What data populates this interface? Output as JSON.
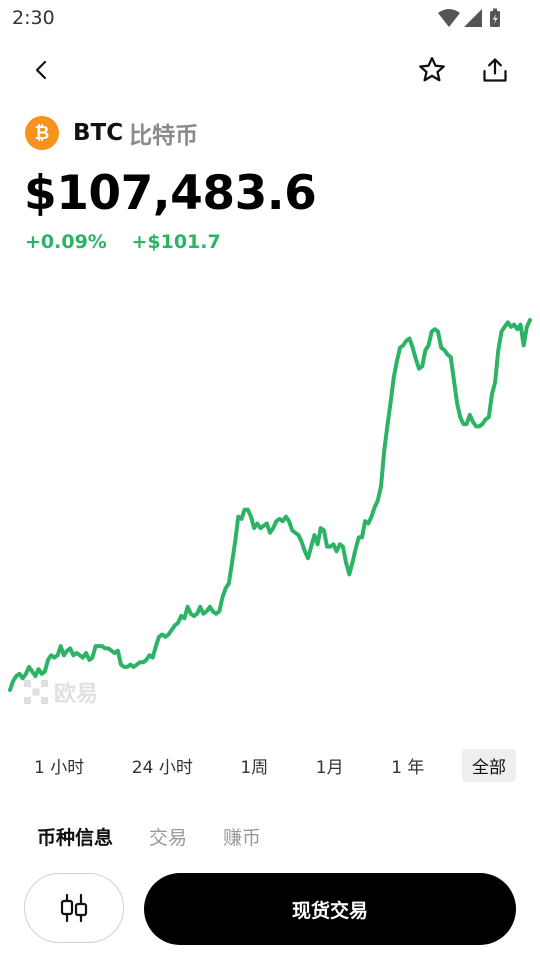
{
  "status_bar": {
    "time": "2:30"
  },
  "coin": {
    "logo_glyph": "₿",
    "logo_color": "#f7931a",
    "symbol": "BTC",
    "name": "比特币"
  },
  "price": "$107,483.6",
  "change": {
    "percent": "+0.09%",
    "amount": "+$101.7",
    "color": "#2db365"
  },
  "watermark": {
    "text": "欧易"
  },
  "chart_data": {
    "type": "line",
    "color": "#2db365",
    "axes_visible": false,
    "grid": false,
    "y": [
      0.05,
      0.09,
      0.11,
      0.12,
      0.1,
      0.12,
      0.15,
      0.13,
      0.11,
      0.14,
      0.12,
      0.13,
      0.18,
      0.2,
      0.19,
      0.2,
      0.24,
      0.2,
      0.22,
      0.23,
      0.2,
      0.21,
      0.2,
      0.19,
      0.21,
      0.18,
      0.19,
      0.24,
      0.24,
      0.24,
      0.23,
      0.23,
      0.22,
      0.21,
      0.22,
      0.16,
      0.15,
      0.15,
      0.16,
      0.15,
      0.16,
      0.17,
      0.17,
      0.18,
      0.2,
      0.19,
      0.24,
      0.28,
      0.29,
      0.28,
      0.29,
      0.31,
      0.33,
      0.34,
      0.37,
      0.36,
      0.41,
      0.38,
      0.37,
      0.38,
      0.41,
      0.38,
      0.39,
      0.41,
      0.39,
      0.38,
      0.39,
      0.45,
      0.49,
      0.51,
      0.6,
      0.69,
      0.8,
      0.79,
      0.83,
      0.83,
      0.8,
      0.75,
      0.77,
      0.75,
      0.76,
      0.77,
      0.73,
      0.75,
      0.78,
      0.79,
      0.78,
      0.8,
      0.78,
      0.74,
      0.73,
      0.72,
      0.69,
      0.65,
      0.62,
      0.67,
      0.72,
      0.68,
      0.75,
      0.74,
      0.67,
      0.67,
      0.68,
      0.65,
      0.68,
      0.67,
      0.6,
      0.55,
      0.6,
      0.66,
      0.71,
      0.71,
      0.78,
      0.77,
      0.8,
      0.84,
      0.87,
      0.93,
      1.08,
      1.19,
      1.29,
      1.4,
      1.47,
      1.53,
      1.54,
      1.56,
      1.57,
      1.53,
      1.48,
      1.44,
      1.45,
      1.52,
      1.54,
      1.6,
      1.61,
      1.6,
      1.53,
      1.52,
      1.5,
      1.49,
      1.39,
      1.29,
      1.23,
      1.2,
      1.2,
      1.24,
      1.21,
      1.19,
      1.19,
      1.2,
      1.22,
      1.23,
      1.33,
      1.38,
      1.52,
      1.6,
      1.62,
      1.64,
      1.62,
      1.63,
      1.61,
      1.63,
      1.54,
      1.62,
      1.65
    ]
  },
  "time_ranges": [
    "1 小时",
    "24 小时",
    "1周",
    "1月",
    "1 年",
    "全部"
  ],
  "active_range": "全部",
  "tabs": [
    "币种信息",
    "交易",
    "赚币"
  ],
  "active_tab": "币种信息",
  "actions": {
    "trade_label": "现货交易"
  }
}
